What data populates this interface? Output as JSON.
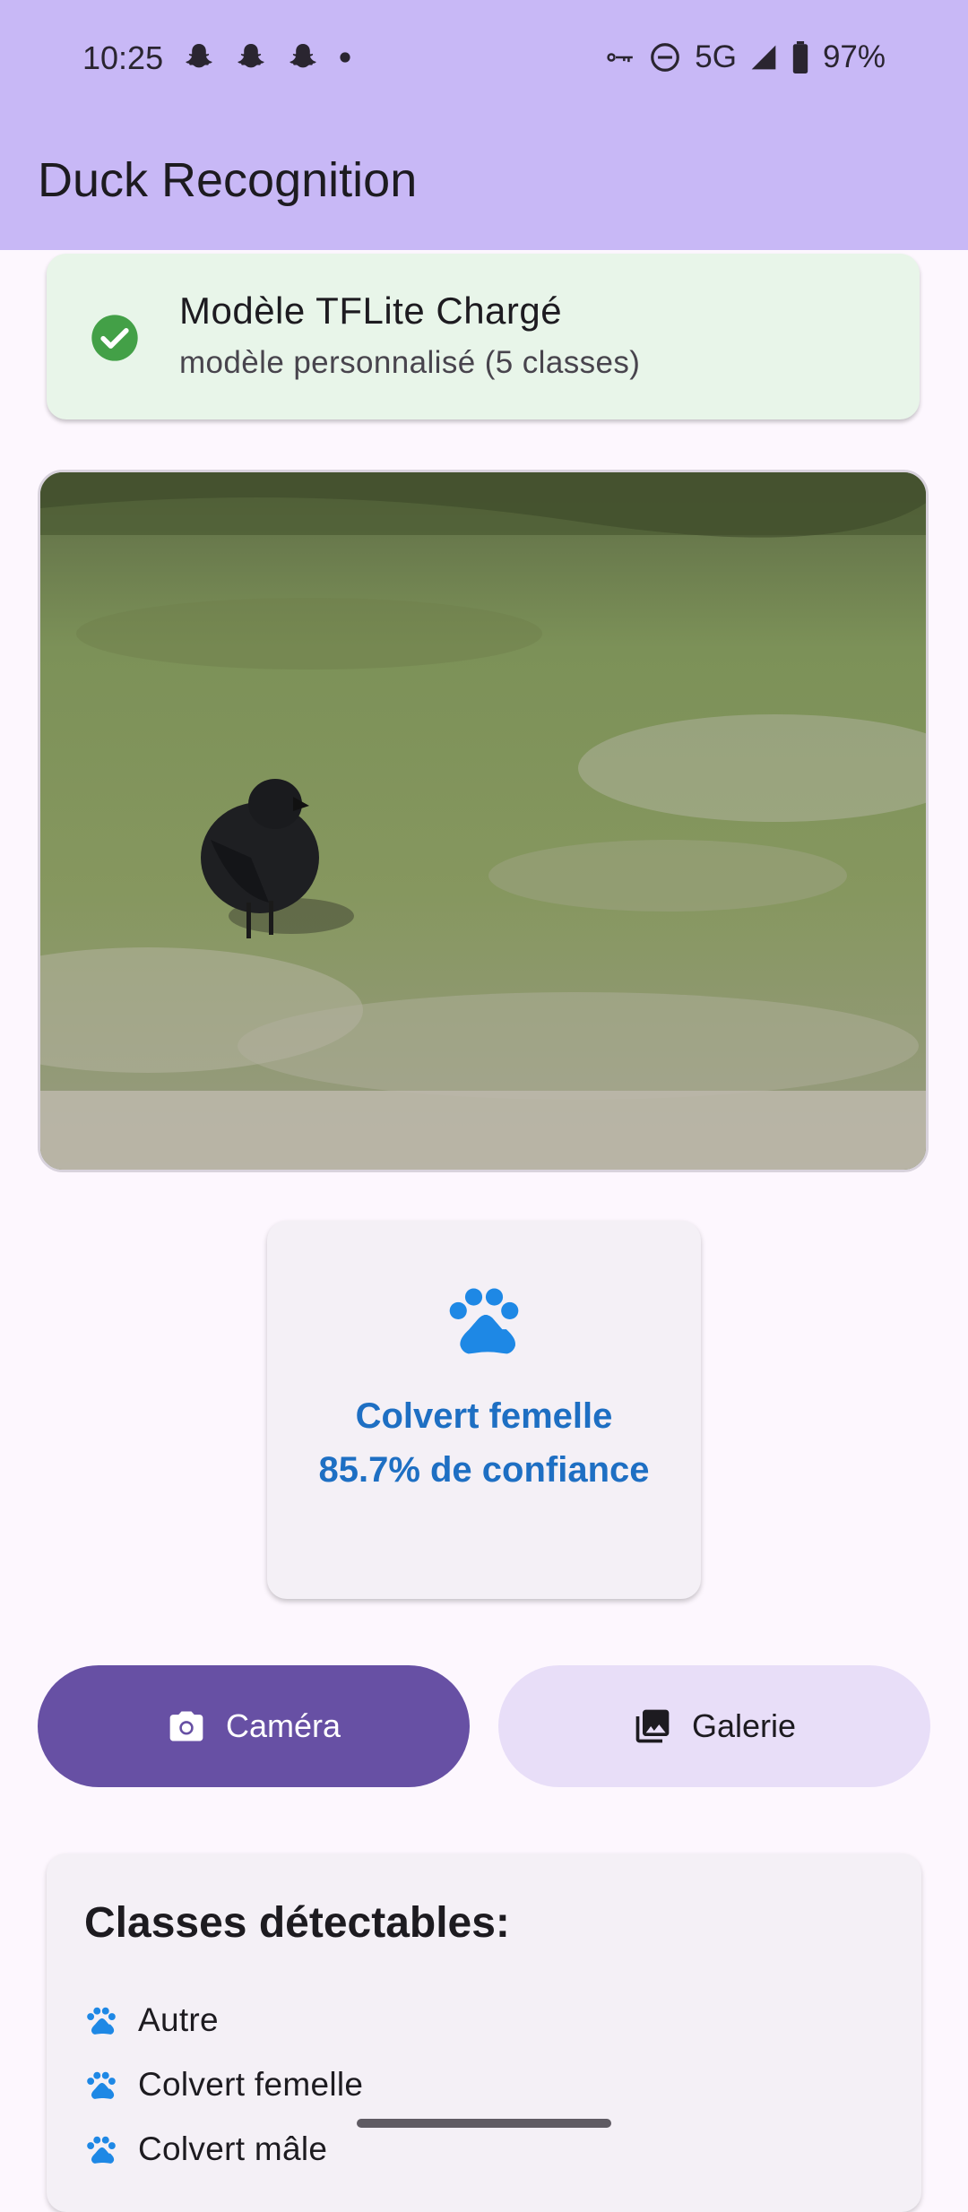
{
  "status_bar": {
    "time": "10:25",
    "notification_icons": [
      "snapchat-icon",
      "snapchat-icon",
      "snapchat-icon",
      "dot-icon"
    ],
    "right_icons": [
      "vpn-key-icon",
      "do-not-disturb-icon"
    ],
    "network": "5G",
    "battery": "97%"
  },
  "app_bar": {
    "title": "Duck Recognition"
  },
  "model_status": {
    "icon": "check-circle-icon",
    "title": "Modèle TFLite Chargé",
    "subtitle": "modèle personnalisé (5 classes)",
    "color": "#e8f5e9"
  },
  "photo": {
    "subject": "black bird on grass and gravel"
  },
  "result": {
    "icon": "paw-icon",
    "label": "Colvert femelle",
    "confidence_text": "85.7% de confiance",
    "color": "#1e6fc3"
  },
  "actions": {
    "camera_label": "Caméra",
    "gallery_label": "Galerie",
    "primary_color": "#6750a4",
    "secondary_color": "#e8def8"
  },
  "classes": {
    "title": "Classes détectables:",
    "items": [
      "Autre",
      "Colvert femelle",
      "Colvert mâle"
    ]
  }
}
